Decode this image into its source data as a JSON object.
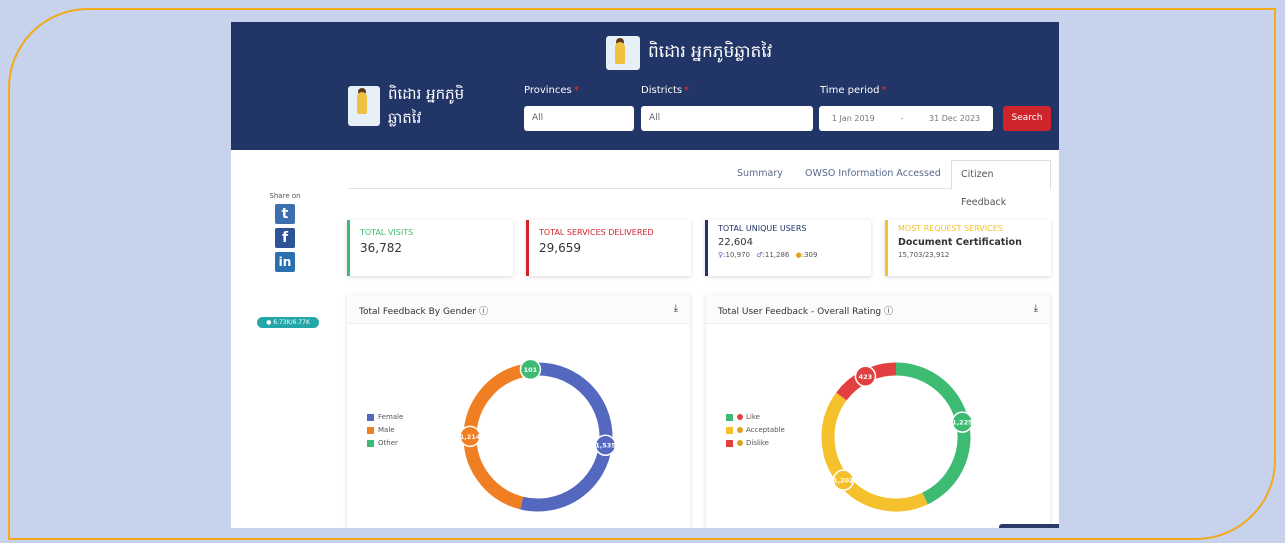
{
  "header": {
    "title": "ពិដោរ អ្នកភូមិឆ្លាតវៃ",
    "side_title": "ពិដោរ អ្នកភូមិ ឆ្លាតវៃ"
  },
  "filters": {
    "provinces_label": "Provinces",
    "provinces_value": "All",
    "districts_label": "Districts",
    "districts_value": "All",
    "time_label": "Time period",
    "time_from": "1 Jan 2019",
    "time_to": "31 Dec 2023",
    "search_label": "Search"
  },
  "tabs": [
    "Summary",
    "OWSO Information Accessed",
    "Citizen Feedback"
  ],
  "share": {
    "label": "Share on",
    "views": "6.73K/6.77K"
  },
  "cards": {
    "visits": {
      "title": "TOTAL VISITS",
      "value": "36,782"
    },
    "services": {
      "title": "TOTAL SERVICES DELIVERED",
      "value": "29,659"
    },
    "users": {
      "title": "TOTAL UNIQUE USERS",
      "value": "22,604",
      "female": "10,970",
      "male": "11,286",
      "other": "309"
    },
    "request": {
      "title": "MOST REQUEST SERVICES",
      "value": "Document Certification",
      "sub": "15,703/23,912"
    }
  },
  "colors": {
    "navy": "#223567",
    "female": "#5468c0",
    "male": "#f07f23",
    "other": "#3dbb73",
    "like": "#3dbb73",
    "acceptable": "#f4c02b",
    "dislike": "#e24040",
    "search": "#d0242c"
  },
  "chart_data": [
    {
      "type": "pie",
      "title": "Total Feedback By Gender",
      "categories": [
        "Female",
        "Male",
        "Other"
      ],
      "values": [
        1535,
        1214,
        101
      ],
      "labels": [
        "1,535",
        "1,214",
        "101"
      ]
    },
    {
      "type": "pie",
      "title": "Total User Feedback - Overall Rating",
      "categories": [
        "Like",
        "Acceptable",
        "Dislike"
      ],
      "values": [
        1225,
        1202,
        423
      ],
      "labels": [
        "1,225",
        "1,202",
        "423"
      ]
    }
  ]
}
